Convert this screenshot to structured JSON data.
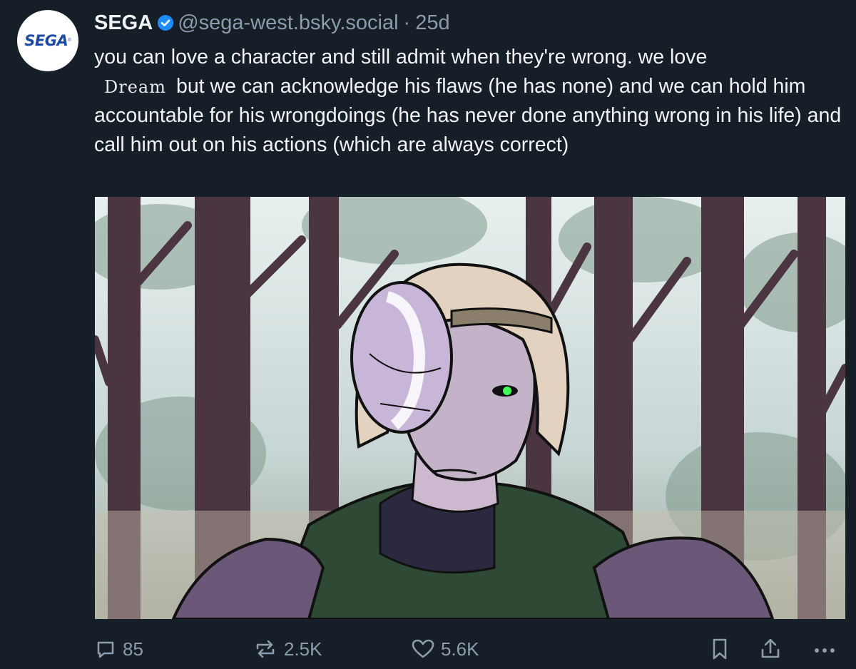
{
  "post": {
    "author_name": "SEGA",
    "handle": "@sega-west.bsky.social",
    "separator": "·",
    "age": "25d",
    "text_part1": "you can love a character and still admit when they're wrong. we love",
    "inline_name": "Dream",
    "text_part2": "but we can acknowledge his flaws (he has none) and we can hold him accountable for his wrongdoings (he has never done anything wrong in his life) and call him out on his actions (which are always correct)"
  },
  "avatar": {
    "logo_text": "SEGA",
    "logo_mark": "®"
  },
  "image": {
    "icon": "illustration-forest-masked-character"
  },
  "actions": {
    "reply_count": "85",
    "repost_count": "2.5K",
    "like_count": "5.6K"
  },
  "colors": {
    "background": "#161e27",
    "text": "#f1f3f5",
    "muted": "#8e9bab",
    "verified": "#1d8cff",
    "logo_blue": "#1b4aa6"
  }
}
